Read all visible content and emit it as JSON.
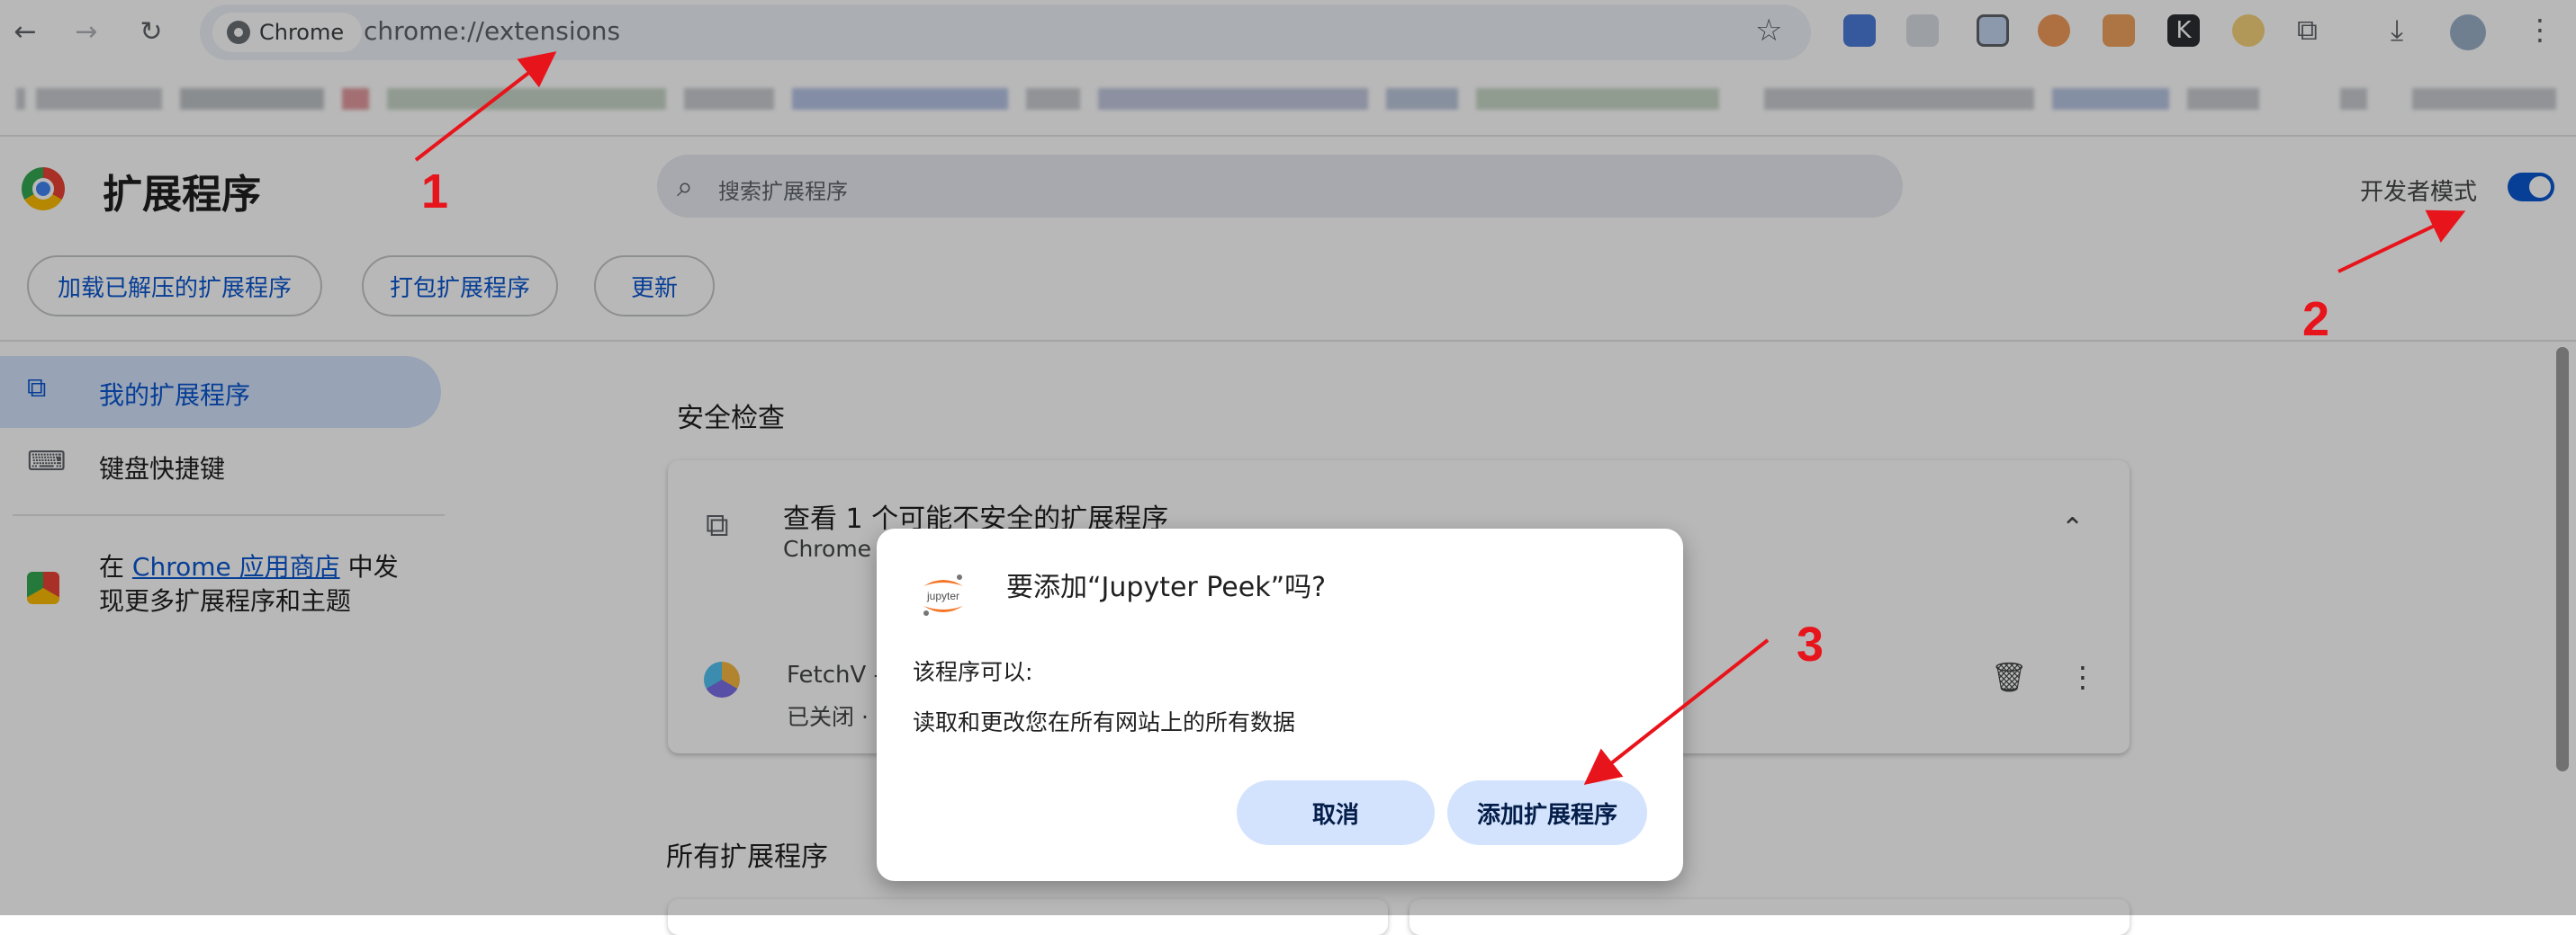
{
  "toolbar": {
    "chip_label": "Chrome",
    "url": "chrome://extensions"
  },
  "header": {
    "title": "扩展程序",
    "search_placeholder": "搜索扩展程序",
    "dev_mode_label": "开发者模式",
    "dev_mode_on": true
  },
  "actions": {
    "load_unpacked": "加载已解压的扩展程序",
    "pack": "打包扩展程序",
    "update": "更新"
  },
  "sidebar": {
    "items": [
      {
        "label": "我的扩展程序",
        "active": true
      },
      {
        "label": "键盘快捷键",
        "active": false
      }
    ],
    "store_prefix": "在",
    "store_link": "Chrome 应用商店",
    "store_suffix": "中发",
    "store_line2": "现更多扩展程序和主题"
  },
  "main": {
    "safety_title": "安全检查",
    "safety_card": {
      "heading": "查看 1 个可能不安全的扩展程序",
      "subtext": "Chrome",
      "item_name": "FetchV -",
      "item_status": "已关闭 ·"
    },
    "all_title": "所有扩展程序"
  },
  "dialog": {
    "title": "要添加“Jupyter Peek”吗?",
    "can_label": "该程序可以:",
    "permission": "读取和更改您在所有网站上的所有数据",
    "cancel": "取消",
    "add": "添加扩展程序",
    "logo_text": "jupyter"
  },
  "annotations": [
    "1",
    "2",
    "3"
  ],
  "colors": {
    "accent": "#0b57d0",
    "annotation": "#e8141b",
    "active_bg": "#d3e3fd"
  }
}
